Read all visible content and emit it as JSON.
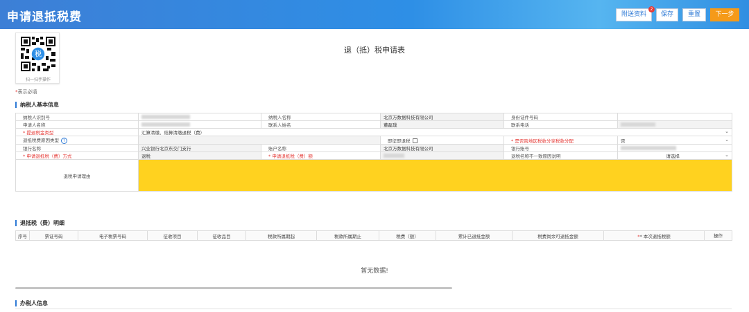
{
  "header": {
    "title": "申请退抵税费",
    "buttons": {
      "attachments": "附送资料",
      "save": "保存",
      "reset": "重置",
      "next": "下一步"
    },
    "attachment_badge": "2"
  },
  "qr": {
    "caption": "扫一扫手操作"
  },
  "form_title": "退（抵）税申请表",
  "required_note": "表示必填",
  "section_basic": "纳税人基本信息",
  "basic_rows": {
    "r1": {
      "l1": "纳税人识别号",
      "l2": "纳税人名称",
      "v2": "北京万数据科技有限公司",
      "l3": "身份证件号码"
    },
    "r2": {
      "l1": "申请人名称",
      "l2": "联系人姓名",
      "v2": "董磊璞",
      "l3": "联系电话"
    },
    "r3": {
      "l1": "* 提退税金类型",
      "v1": "汇算清缴、结算清缴退税（费）"
    },
    "r4": {
      "l1": "退抵税费原因类型",
      "l2": "即征即退税",
      "l3": "* 是否跨地区税收分享税款分配",
      "v3": "否"
    },
    "r5": {
      "l1": "银行名称",
      "v1": "兴业银行北京东交门支行",
      "l2": "账户名称",
      "v2": "北京万数据科技有限公司",
      "l3": "银行账号"
    },
    "r6": {
      "l1": "* 申请退抵税（费）方式",
      "v1": "退税",
      "l2": "* 申请退抵税（费）额",
      "l3": "退税名称不一致原因说明",
      "v3": "请选择"
    },
    "r7": {
      "l1": "退税申请理由"
    }
  },
  "section_details": "退抵税（费）明细",
  "detail_headers": [
    "序号",
    "票证号码",
    "电子税票号码",
    "征收项目",
    "征收品目",
    "税款所属期起",
    "税款所属期止",
    "税费（额）",
    "累计已退抵金额",
    "税费尚余可退抵金额",
    "* 本次退抵税额",
    "操作"
  ],
  "empty_text": "暂无数据!",
  "section_handler": "办税人信息"
}
